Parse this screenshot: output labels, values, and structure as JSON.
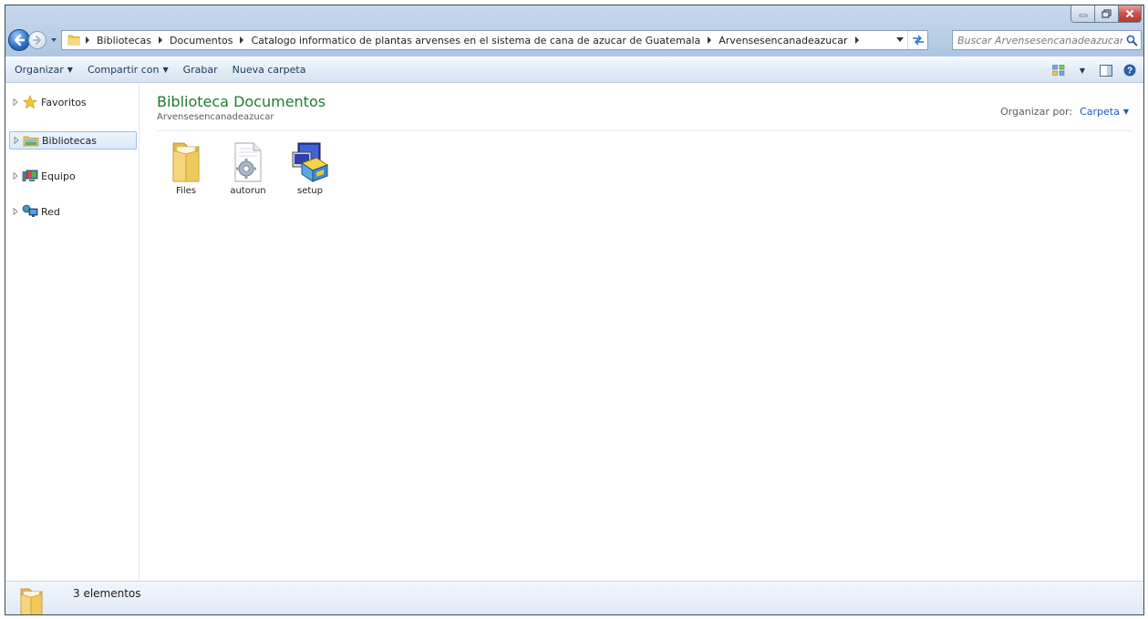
{
  "window": {
    "accent_color": "#1e7b34",
    "link_color": "#1e5bbb"
  },
  "address_bar": {
    "breadcrumbs": [
      "Bibliotecas",
      "Documentos",
      "Catalogo informatico de plantas arvenses en el sistema de cana de azucar de Guatemala",
      "Arvensesencanadeazucar"
    ]
  },
  "search": {
    "placeholder": "Buscar Arvensesencanadeazucar"
  },
  "command_bar": {
    "organize_label": "Organizar",
    "share_label": "Compartir con",
    "burn_label": "Grabar",
    "new_folder_label": "Nueva carpeta"
  },
  "nav_pane": {
    "items": [
      {
        "label": "Favoritos",
        "icon": "star-icon"
      },
      {
        "label": "Bibliotecas",
        "icon": "libraries-icon",
        "selected": true
      },
      {
        "label": "Equipo",
        "icon": "computer-icon"
      },
      {
        "label": "Red",
        "icon": "network-icon"
      }
    ]
  },
  "content": {
    "title": "Biblioteca Documentos",
    "subtitle": "Arvensesencanadeazucar",
    "arrange_by_label": "Organizar por:",
    "arrange_by_value": "Carpeta",
    "items": [
      {
        "label": "Files",
        "icon": "folder-icon"
      },
      {
        "label": "autorun",
        "icon": "config-file-icon"
      },
      {
        "label": "setup",
        "icon": "setup-program-icon"
      }
    ]
  },
  "status_bar": {
    "item_count": "3 elementos"
  }
}
